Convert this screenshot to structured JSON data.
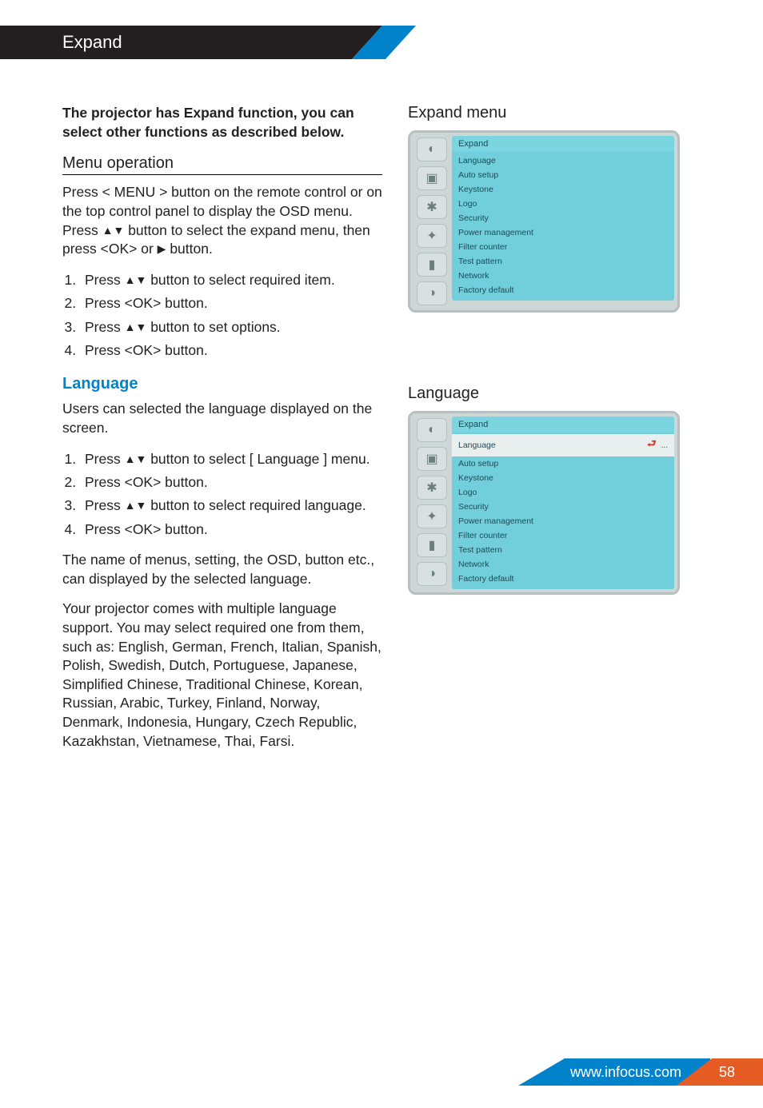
{
  "header": {
    "title": "Expand"
  },
  "intro": "The projector has Expand function, you can select other functions as described below.",
  "menu_op": {
    "heading": "Menu operation",
    "para_prefix": "Press < MENU > button on the remote control or on the top control panel to display the OSD menu. Press ",
    "para_mid": " button to select the expand menu, then press <OK> or ",
    "para_suffix": " button.",
    "steps_prefix": [
      "Press ",
      "Press <OK> button.",
      "Press ",
      "Press <OK> button."
    ],
    "step1_suffix": " button to select required item.",
    "step3_suffix": " button to set options."
  },
  "language": {
    "heading": "Language",
    "para1": "Users can selected the language displayed on the screen.",
    "step1_prefix": "Press ",
    "step1_suffix": " button to select [ Language ] menu.",
    "step2": "Press <OK> button.",
    "step3_prefix": "Press ",
    "step3_suffix": " button to select required language.",
    "step4": "Press <OK> button.",
    "para2": "The name of menus, setting, the OSD, button etc., can displayed by the selected language.",
    "para3": "Your projector comes with multiple language support. You may select required one from them, such as: English, German, French, Italian, Spanish, Polish, Swedish, Dutch, Portuguese, Japanese, Simplified Chinese, Traditional Chinese, Korean, Russian, Arabic, Turkey, Finland, Norway, Denmark, Indonesia, Hungary, Czech Republic, Kazakhstan, Vietnamese, Thai, Farsi."
  },
  "osd1": {
    "title": "Expand menu",
    "head": "Expand",
    "items": [
      "Language",
      "Auto setup",
      "Keystone",
      "Logo",
      "Security",
      "Power management",
      "Filter counter",
      "Test pattern",
      "Network",
      "Factory default"
    ]
  },
  "osd2": {
    "title": "Language",
    "head": "Expand",
    "items": [
      "Language",
      "Auto setup",
      "Keystone",
      "Logo",
      "Security",
      "Power management",
      "Filter counter",
      "Test pattern",
      "Network",
      "Factory default"
    ],
    "selected_value": "..."
  },
  "footer": {
    "url": "www.infocus.com",
    "page": "58"
  }
}
